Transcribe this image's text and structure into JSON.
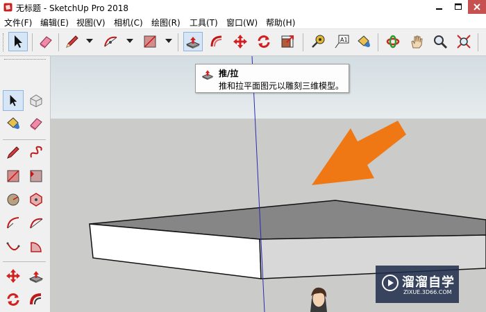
{
  "window": {
    "title": "无标题 - SketchUp Pro 2018",
    "minimize_icon": "minimize-icon",
    "maximize_icon": "maximize-icon",
    "close_icon": "close-icon"
  },
  "menu": [
    {
      "label": "文件(F)"
    },
    {
      "label": "编辑(E)"
    },
    {
      "label": "视图(V)"
    },
    {
      "label": "相机(C)"
    },
    {
      "label": "绘图(R)"
    },
    {
      "label": "工具(T)"
    },
    {
      "label": "窗口(W)"
    },
    {
      "label": "帮助(H)"
    }
  ],
  "toolbar": {
    "tools": [
      {
        "icon": "select-arrow-icon",
        "selected": true
      },
      {
        "icon": "eraser-icon"
      },
      {
        "icon": "pencil-line-icon",
        "dropdown": true
      },
      {
        "icon": "arc-icon",
        "dropdown": true
      },
      {
        "icon": "rectangle-icon",
        "dropdown": true
      },
      {
        "icon": "push-pull-icon",
        "hovered": true
      },
      {
        "icon": "follow-me-icon"
      },
      {
        "icon": "move-icon"
      },
      {
        "icon": "rotate-icon"
      },
      {
        "icon": "scale-icon"
      },
      {
        "icon": "tape-measure-icon"
      },
      {
        "icon": "text-label-icon"
      },
      {
        "icon": "paint-bucket-icon"
      },
      {
        "icon": "orbit-icon"
      },
      {
        "icon": "pan-hand-icon"
      },
      {
        "icon": "zoom-icon"
      },
      {
        "icon": "zoom-extents-icon"
      }
    ],
    "text_tool_label": "A1"
  },
  "left_toolbar": {
    "tools": [
      "select-arrow-icon",
      "make-component-icon",
      "paint-bucket-icon",
      "eraser-icon",
      "line-icon",
      "freehand-icon",
      "rectangle-icon",
      "rotated-rectangle-icon",
      "circle-icon",
      "polygon-icon",
      "arc-icon",
      "two-point-arc-icon",
      "three-point-arc-icon",
      "pie-icon",
      "move-icon",
      "push-pull-icon",
      "rotate-icon",
      "follow-me-icon"
    ]
  },
  "tooltip": {
    "title": "推/拉",
    "description": "推和拉平面图元以雕刻三维模型。",
    "icon": "push-pull-icon"
  },
  "viewport": {
    "sky_color": "#dfe6ea",
    "ground_color": "#cbcbc9",
    "arrow_color": "#f07814",
    "axis_color": "#2a2ab0",
    "figure": "person-figure-icon"
  },
  "watermark": {
    "name": "溜溜自学",
    "url": "ZIXUE.3D66.COM",
    "logo": "play-logo-icon"
  }
}
